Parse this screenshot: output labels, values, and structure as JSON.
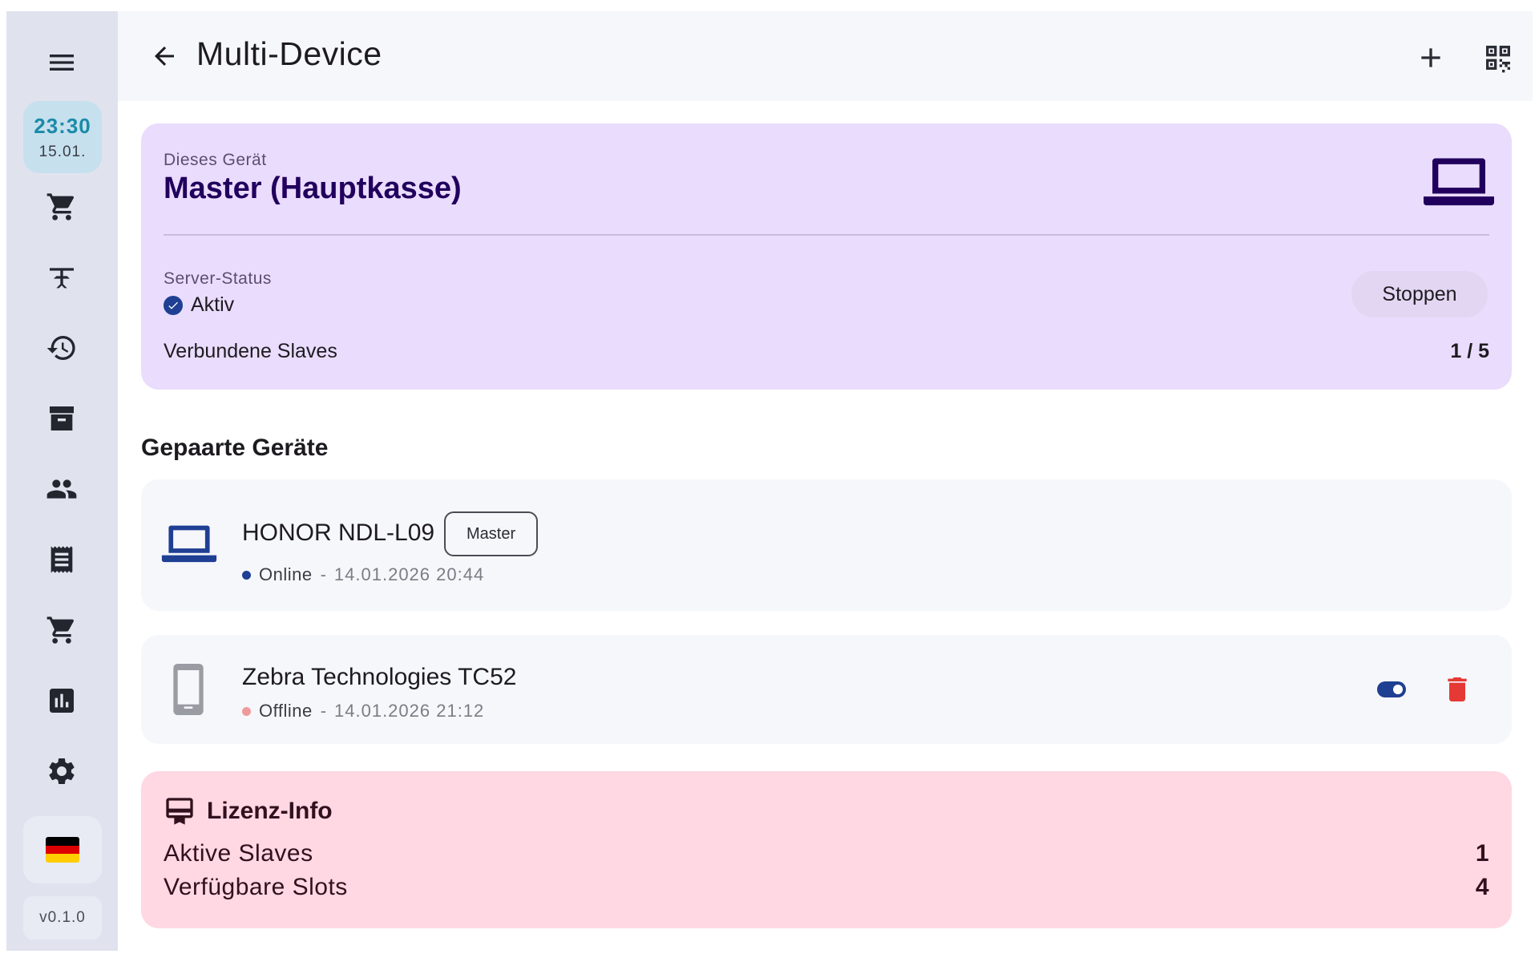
{
  "sidebar": {
    "clock_time": "23:30",
    "clock_date": "15.01.",
    "version": "v0.1.0",
    "icons": [
      "menu-icon",
      "cart-icon",
      "table-icon",
      "history-icon",
      "archive-icon",
      "people-icon",
      "receipt-icon",
      "cart-icon",
      "chart-icon",
      "settings-icon"
    ],
    "flag_colors": [
      "#000000",
      "#dd0000",
      "#ffce00"
    ]
  },
  "header": {
    "title": "Multi-Device"
  },
  "master_card": {
    "label": "Dieses Gerät",
    "title": "Master (Hauptkasse)",
    "server_status_label": "Server-Status",
    "server_status_value": "Aktiv",
    "stop_button": "Stoppen",
    "connected_label": "Verbundene Slaves",
    "connected_value": "1 / 5"
  },
  "paired_section": {
    "title": "Gepaarte Geräte",
    "devices": [
      {
        "name": "HONOR NDL-L09",
        "badge": "Master",
        "status": "Online",
        "separator": "-",
        "timestamp": "14.01.2026 20:44",
        "status_color": "#1f3f93",
        "icon": "laptop-icon"
      },
      {
        "name": "Zebra Technologies TC52",
        "status": "Offline",
        "separator": "-",
        "timestamp": "14.01.2026 21:12",
        "status_color": "#ef9a9a",
        "icon": "phone-icon",
        "enabled": true
      }
    ]
  },
  "license": {
    "title": "Lizenz-Info",
    "rows": [
      {
        "label": "Aktive Slaves",
        "value": "1"
      },
      {
        "label": "Verfügbare Slots",
        "value": "4"
      }
    ]
  },
  "colors": {
    "accent": "#1f3f93",
    "master_bg": "#eadcfd",
    "license_bg": "#ffd8e4",
    "danger": "#e53935"
  }
}
